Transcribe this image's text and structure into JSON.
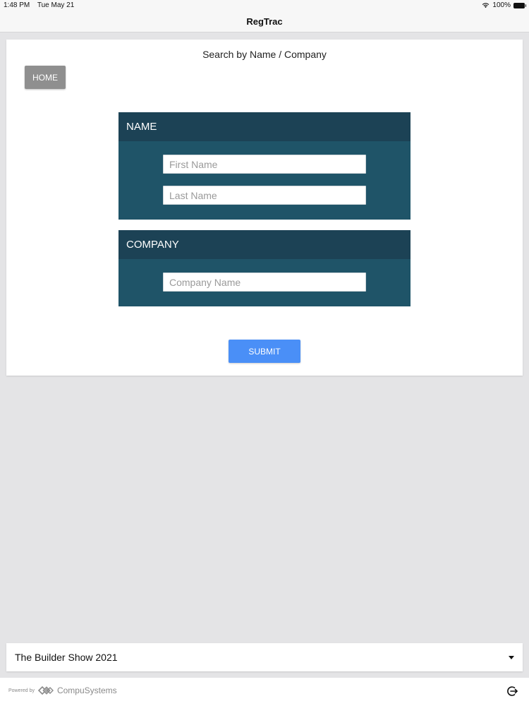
{
  "status_bar": {
    "time": "1:48 PM",
    "date": "Tue May 21",
    "battery": "100%"
  },
  "nav": {
    "title": "RegTrac"
  },
  "page": {
    "title": "Search by Name / Company",
    "home_label": "HOME",
    "submit_label": "SUBMIT"
  },
  "name_panel": {
    "header": "NAME",
    "first_name_placeholder": "First Name",
    "last_name_placeholder": "Last Name"
  },
  "company_panel": {
    "header": "COMPANY",
    "company_placeholder": "Company Name"
  },
  "event_selector": {
    "selected": "The Builder Show 2021"
  },
  "footer": {
    "powered_by": "Powered by",
    "brand": "CompuSystems"
  },
  "icons": {
    "wifi": "wifi-icon",
    "battery": "battery-icon",
    "caret": "caret-down-icon",
    "logo": "compusystems-logo-icon",
    "logout": "logout-icon"
  },
  "colors": {
    "panel_header": "#1c4255",
    "panel_body": "#1f5468",
    "submit": "#4a8ff7",
    "home": "#8f8f8f",
    "background": "#e4e4e6"
  }
}
